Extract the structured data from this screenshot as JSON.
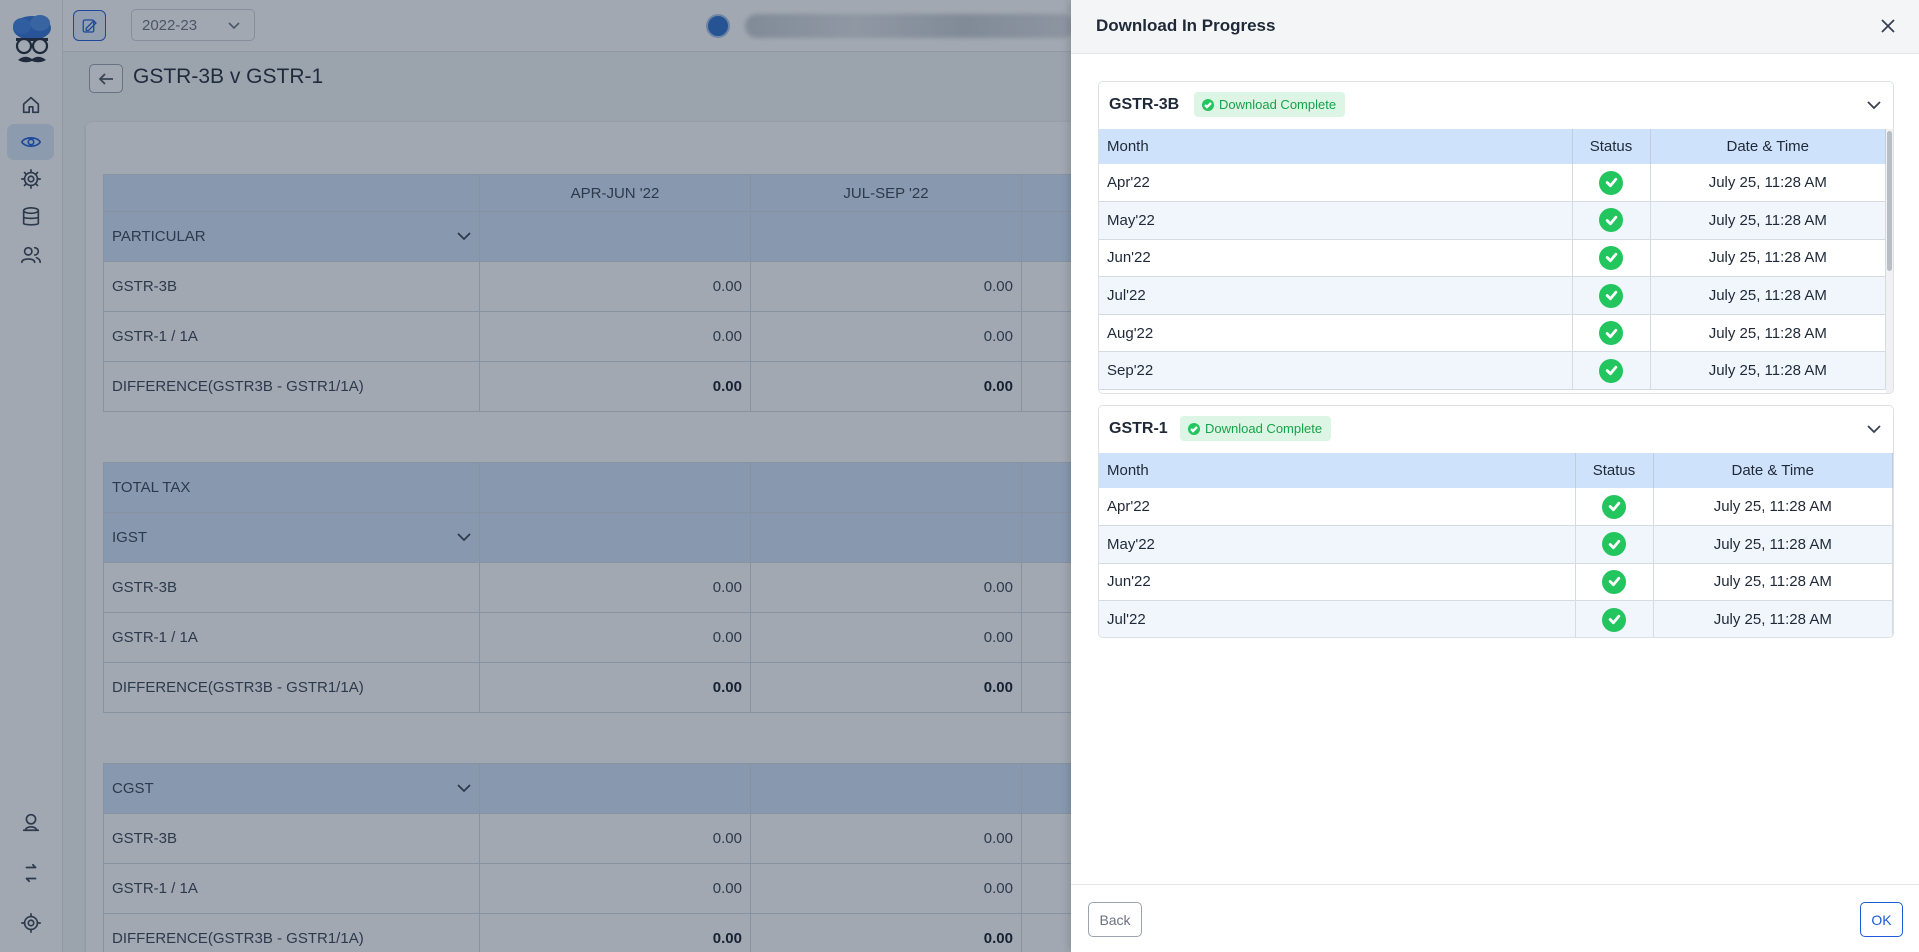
{
  "topbar": {
    "year": "2022-23"
  },
  "page": {
    "title": "GSTR-3B v GSTR-1"
  },
  "report": {
    "columns": [
      "",
      "APR-JUN '22",
      "JUL-SEP '22",
      ""
    ],
    "sections": [
      {
        "header": "PARTICULAR",
        "rows": [
          {
            "label": "GSTR-3B",
            "q1": "0.00",
            "q2": "0.00"
          },
          {
            "label": "GSTR-1 / 1A",
            "q1": "0.00",
            "q2": "0.00"
          },
          {
            "label": "DIFFERENCE(GSTR3B - GSTR1/1A)",
            "q1": "0.00",
            "q2": "0.00"
          }
        ]
      },
      {
        "group": "TOTAL TAX",
        "header": "IGST",
        "rows": [
          {
            "label": "GSTR-3B",
            "q1": "0.00",
            "q2": "0.00"
          },
          {
            "label": "GSTR-1 / 1A",
            "q1": "0.00",
            "q2": "0.00"
          },
          {
            "label": "DIFFERENCE(GSTR3B - GSTR1/1A)",
            "q1": "0.00",
            "q2": "0.00"
          }
        ]
      },
      {
        "header": "CGST",
        "rows": [
          {
            "label": "GSTR-3B",
            "q1": "0.00",
            "q2": "0.00"
          },
          {
            "label": "GSTR-1 / 1A",
            "q1": "0.00",
            "q2": "0.00"
          },
          {
            "label": "DIFFERENCE(GSTR3B - GSTR1/1A)",
            "q1": "0.00",
            "q2": "0.00"
          }
        ]
      }
    ]
  },
  "drawer": {
    "title": "Download In Progress",
    "columns": {
      "month": "Month",
      "status": "Status",
      "datetime": "Date & Time"
    },
    "panels": [
      {
        "name": "GSTR-3B",
        "badge": "Download Complete",
        "rows": [
          {
            "month": "Apr'22",
            "datetime": "July 25, 11:28 AM"
          },
          {
            "month": "May'22",
            "datetime": "July 25, 11:28 AM"
          },
          {
            "month": "Jun'22",
            "datetime": "July 25, 11:28 AM"
          },
          {
            "month": "Jul'22",
            "datetime": "July 25, 11:28 AM"
          },
          {
            "month": "Aug'22",
            "datetime": "July 25, 11:28 AM"
          },
          {
            "month": "Sep'22",
            "datetime": "July 25, 11:28 AM"
          }
        ]
      },
      {
        "name": "GSTR-1",
        "badge": "Download Complete",
        "rows": [
          {
            "month": "Apr'22",
            "datetime": "July 25, 11:28 AM"
          },
          {
            "month": "May'22",
            "datetime": "July 25, 11:28 AM"
          },
          {
            "month": "Jun'22",
            "datetime": "July 25, 11:28 AM"
          },
          {
            "month": "Jul'22",
            "datetime": "July 25, 11:28 AM"
          }
        ]
      }
    ],
    "footer": {
      "back": "Back",
      "ok": "OK"
    }
  },
  "colors": {
    "accent": "#1e5bd8",
    "success": "#22c55e",
    "table_header": "#cfe2fb"
  }
}
